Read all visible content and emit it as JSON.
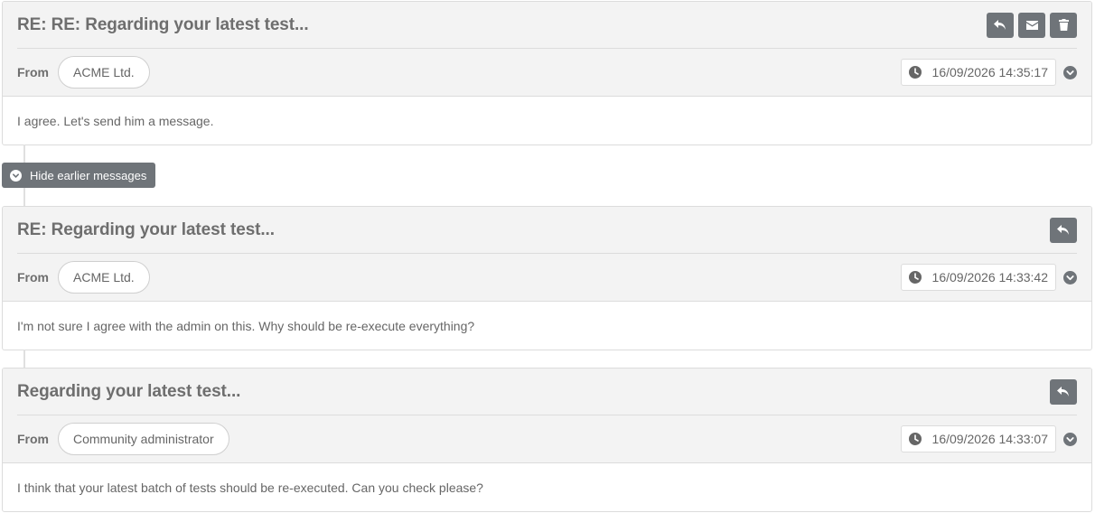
{
  "colors": {
    "header_bg": "#f3f3f3",
    "button_bg": "#6f7479",
    "border": "#dcdcdc",
    "text": "#666666"
  },
  "toggle": {
    "label": "Hide earlier messages",
    "icon": "chevron-down-circle-icon"
  },
  "messages": [
    {
      "subject": "RE: RE: Regarding your latest test...",
      "from_label": "From",
      "sender": "ACME Ltd.",
      "datetime": "16/09/2026 14:35:17",
      "body": "I agree. Let's send him a message.",
      "actions": [
        "reply-icon",
        "envelope-icon",
        "trash-icon"
      ]
    },
    {
      "subject": "RE: Regarding your latest test...",
      "from_label": "From",
      "sender": "ACME Ltd.",
      "datetime": "16/09/2026 14:33:42",
      "body": "I'm not sure I agree with the admin on this. Why should be re-execute everything?",
      "actions": [
        "reply-icon"
      ]
    },
    {
      "subject": "Regarding your latest test...",
      "from_label": "From",
      "sender": "Community administrator",
      "datetime": "16/09/2026 14:33:07",
      "body": "I think that your latest batch of tests should be re-executed. Can you check please?",
      "actions": [
        "reply-icon"
      ]
    }
  ]
}
